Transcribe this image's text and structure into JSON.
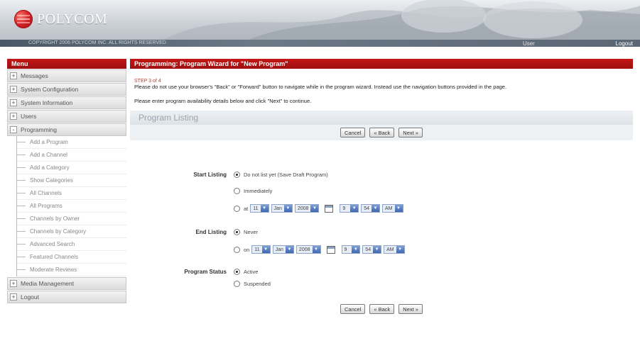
{
  "header": {
    "brand": "POLYCOM",
    "copyright": "COPYRIGHT 2006 POLYCOM INC. ALL RIGHTS RESERVED",
    "user_label": "User",
    "logout_label": "Logout"
  },
  "sidebar": {
    "title": "Menu",
    "top_items": [
      {
        "label": "Messages",
        "toggle": "+"
      },
      {
        "label": "System Configuration",
        "toggle": "+"
      },
      {
        "label": "System Information",
        "toggle": "+"
      },
      {
        "label": "Users",
        "toggle": "+"
      },
      {
        "label": "Programming",
        "toggle": "-"
      }
    ],
    "programming_items": [
      "Add a Program",
      "Add a Channel",
      "Add a Category",
      "Show Categories",
      "All Channels",
      "All Programs",
      "Channels by Owner",
      "Channels by Category",
      "Advanced Search",
      "Featured Channels",
      "Moderate Reviews"
    ],
    "bottom_items": [
      {
        "label": "Media Management",
        "toggle": "+"
      },
      {
        "label": "Logout",
        "toggle": "+"
      }
    ]
  },
  "main": {
    "title": "Programming: Program Wizard for \"New Program\"",
    "step": "STEP 3 of 4",
    "note": "Please do not use your browser's \"Back\" or \"Forward\" button to navigate while in the program wizard. Instead use the navigation buttons provided in the page.",
    "instruction": "Please enter program availability details below and click \"Next\" to continue.",
    "section_title": "Program Listing",
    "buttons": {
      "cancel": "Cancel",
      "back": "« Back",
      "next": "Next »"
    },
    "start_listing": {
      "label": "Start Listing",
      "opt_draft": "Do not list yet (Save Draft Program)",
      "opt_immediately": "Immediately",
      "opt_at_prefix": "at",
      "day": "11",
      "month": "Jan",
      "year": "2008",
      "hour": "9",
      "minute": "54",
      "ampm": "AM",
      "selected": "draft"
    },
    "end_listing": {
      "label": "End Listing",
      "opt_never": "Never",
      "opt_on_prefix": "on",
      "day": "11",
      "month": "Jan",
      "year": "2008",
      "hour": "9",
      "minute": "54",
      "ampm": "AM",
      "selected": "never"
    },
    "program_status": {
      "label": "Program Status",
      "opt_active": "Active",
      "opt_suspended": "Suspended",
      "selected": "active"
    }
  },
  "colors": {
    "accent_red": "#b31212",
    "panel_gray": "#eef1f4",
    "select_blue": "#3e67b0"
  }
}
